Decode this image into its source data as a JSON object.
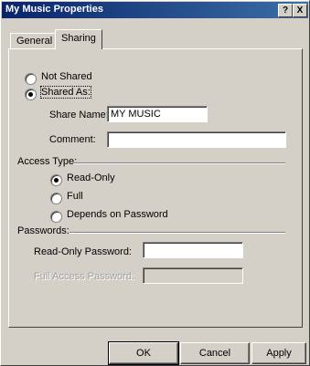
{
  "window": {
    "title": "My Music Properties",
    "help_button": "?",
    "close_button": "X"
  },
  "tabs": [
    {
      "label": "General",
      "selected": false
    },
    {
      "label": "Sharing",
      "selected": true
    }
  ],
  "sharing": {
    "not_shared_label": "Not Shared",
    "shared_as_label": "Shared As:",
    "selected_option": "Shared As",
    "share_name_label": "Share Name:",
    "share_name_value": "MY MUSIC",
    "comment_label": "Comment:",
    "comment_value": "",
    "access_type_label": "Access Type:",
    "access_options": {
      "read_only": "Read-Only",
      "full": "Full",
      "depends": "Depends on Password"
    },
    "access_selected": "Read-Only",
    "passwords_label": "Passwords:",
    "read_only_password_label": "Read-Only Password:",
    "read_only_password_value": "",
    "full_access_password_label": "Full Access Password:",
    "full_access_password_value": ""
  },
  "buttons": {
    "ok": "OK",
    "cancel": "Cancel",
    "apply": "Apply"
  }
}
